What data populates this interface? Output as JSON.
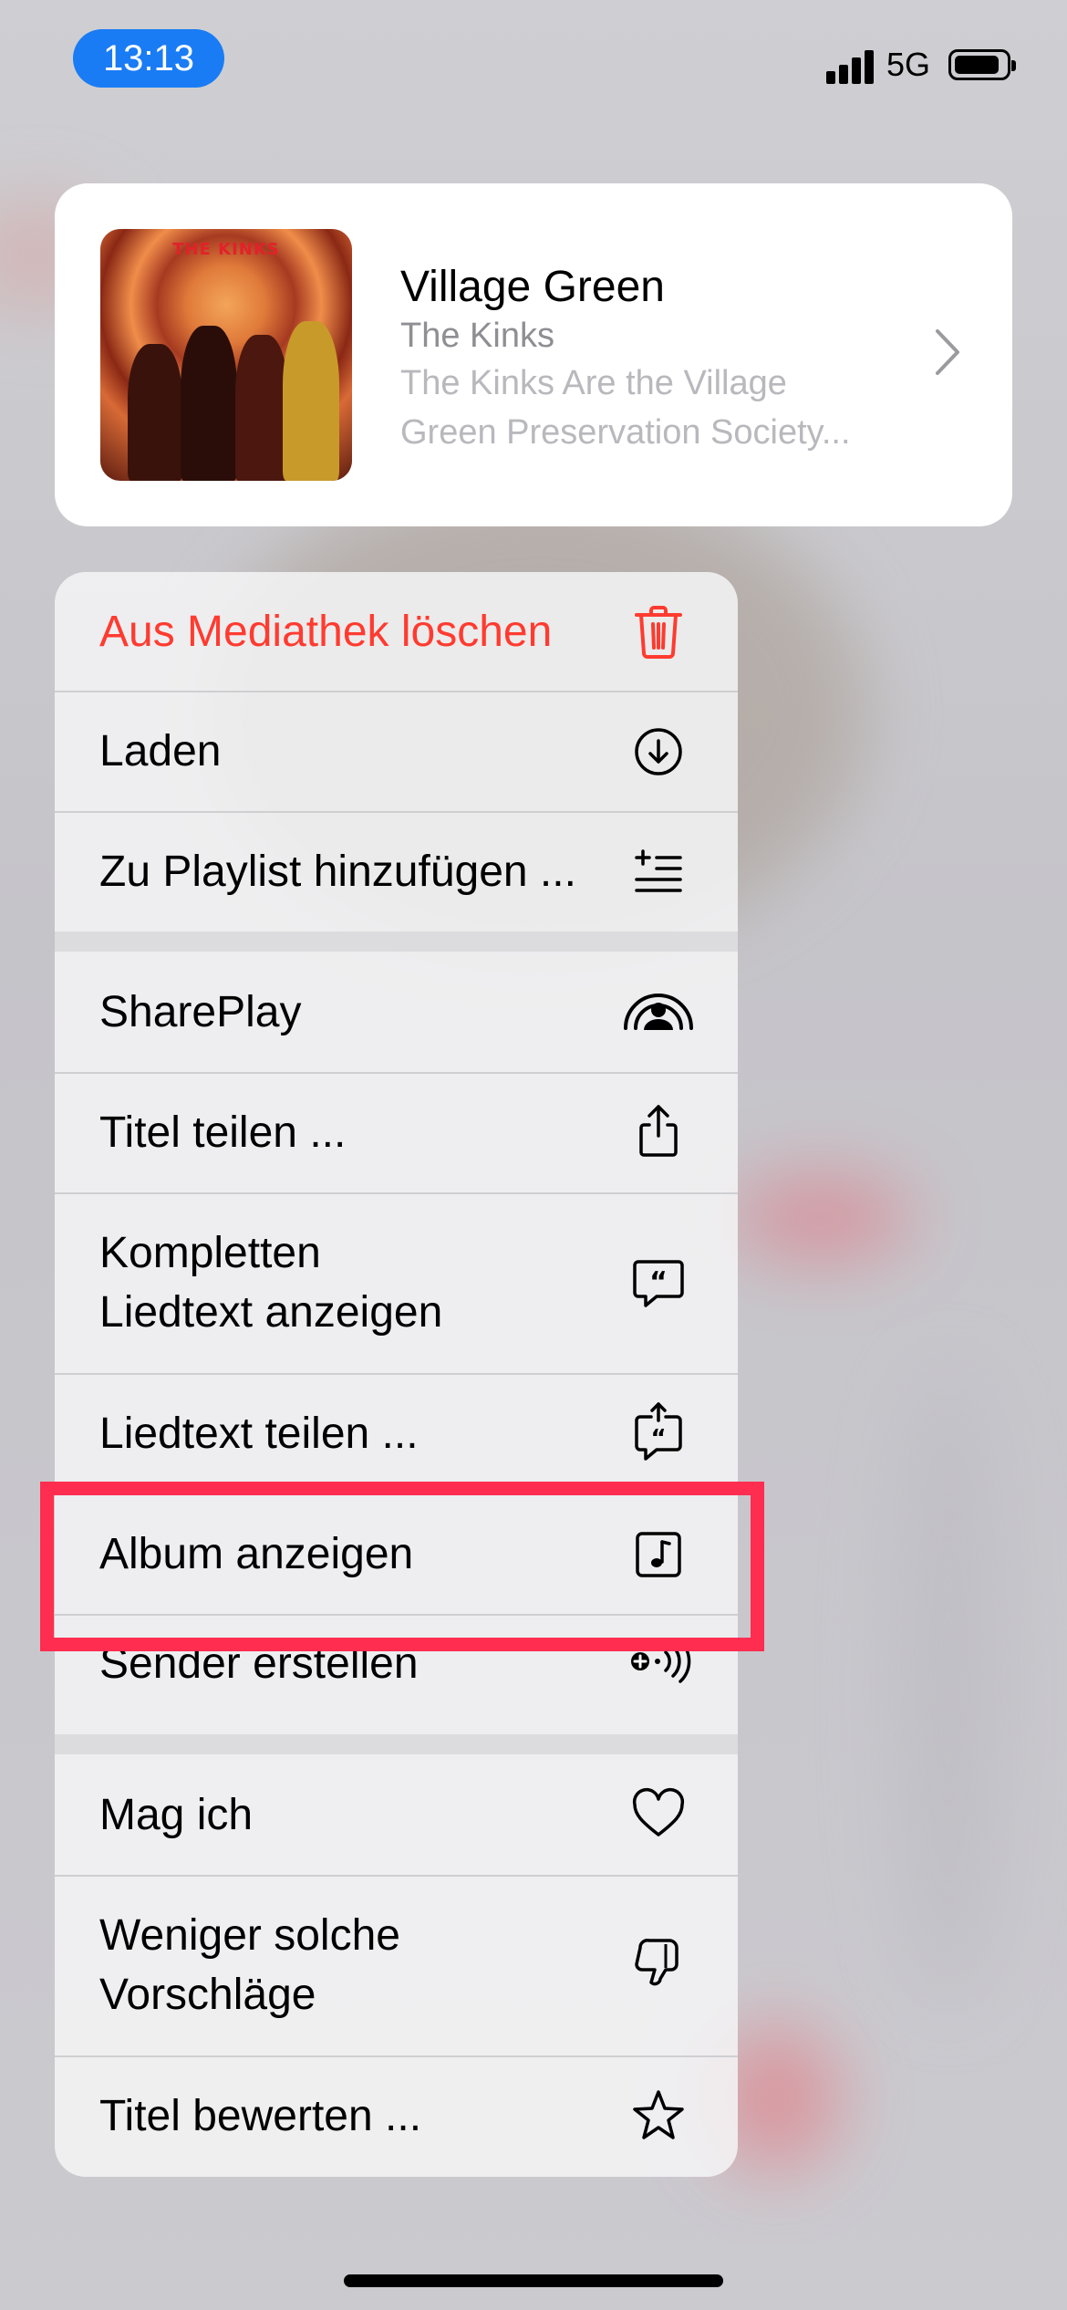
{
  "status_bar": {
    "time": "13:13",
    "network": "5G"
  },
  "song": {
    "title": "Village Green",
    "artist": "The Kinks",
    "album_line1": "The Kinks Are the Village",
    "album_line2": "Green Preservation Society...",
    "cover_band_text": "THE KINKS"
  },
  "menu": {
    "delete": "Aus Mediathek löschen",
    "download": "Laden",
    "add_to_playlist": "Zu Playlist hinzufügen ...",
    "shareplay": "SharePlay",
    "share_song": "Titel teilen ...",
    "show_lyrics_line1": "Kompletten",
    "show_lyrics_line2": "Liedtext anzeigen",
    "share_lyrics": "Liedtext teilen ...",
    "show_album": "Album anzeigen",
    "create_station": "Sender erstellen",
    "love": "Mag ich",
    "suggest_less_line1": "Weniger solche",
    "suggest_less_line2": "Vorschläge",
    "rate_song": "Titel bewerten ..."
  },
  "colors": {
    "destructive": "#ff3b30",
    "highlight": "#ff2d4f",
    "time_pill": "#1a7cf4"
  }
}
